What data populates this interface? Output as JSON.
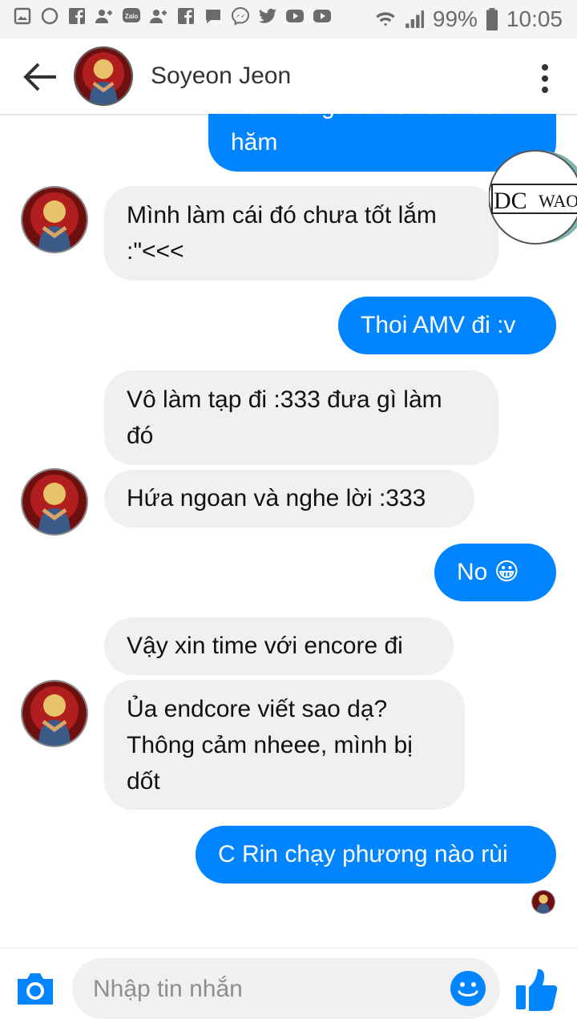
{
  "status_bar": {
    "battery": "99%",
    "time": "10:05",
    "notification_icons": [
      "gallery-icon",
      "circle-icon",
      "facebook-icon",
      "add-friend-icon",
      "zalo-icon",
      "add-friend-icon",
      "facebook-icon",
      "chat-icon",
      "messenger-icon",
      "twitter-icon",
      "youtube-icon",
      "youtube-icon"
    ],
    "zalo_label": "Zalo"
  },
  "header": {
    "contact_name": "Soyeon Jeon"
  },
  "messages": [
    {
      "side": "sent",
      "text": "Bởi manga thì tui lười đó\nhăm"
    },
    {
      "side": "received",
      "text": "Mình làm cái đó chưa tốt lắm\n:\"<<<"
    },
    {
      "side": "sent",
      "text": "Thoi AMV đi :v"
    },
    {
      "side": "received",
      "text": "Vô làm tạp đi :333 đưa gì làm\nđó"
    },
    {
      "side": "received",
      "text": "Hứa ngoan và nghe lời :333"
    },
    {
      "side": "sent",
      "text": "No 😀"
    },
    {
      "side": "received",
      "text": "Vậy xin time với encore đi"
    },
    {
      "side": "received",
      "text": "Ủa endcore viết sao dạ?\nThông cảm nheee, mình bị\ndốt"
    },
    {
      "side": "sent",
      "text": "C Rin chạy phương nào rùi"
    }
  ],
  "overlay_logo": {
    "text_left": "DC",
    "text_right": "WAO"
  },
  "composer": {
    "placeholder": "Nhập tin nhắn"
  },
  "colors": {
    "accent": "#0084ff",
    "received_bubble": "#f0f0f0"
  }
}
